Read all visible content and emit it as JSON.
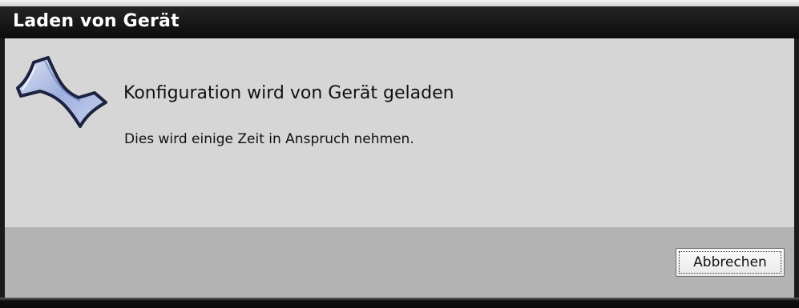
{
  "window": {
    "title": "Laden von Gerät"
  },
  "dialog": {
    "icon": "hourglass-icon",
    "heading": "Konfiguration wird von Gerät geladen",
    "message": "Dies wird einige Zeit in Anspruch nehmen."
  },
  "footer": {
    "cancel_label": "Abbrechen"
  },
  "colors": {
    "titlebar": "#0c0c0c",
    "content_bg": "#d6d6d6",
    "footer_bg": "#b3b3b3",
    "hourglass_blue": "#aab8e0"
  }
}
